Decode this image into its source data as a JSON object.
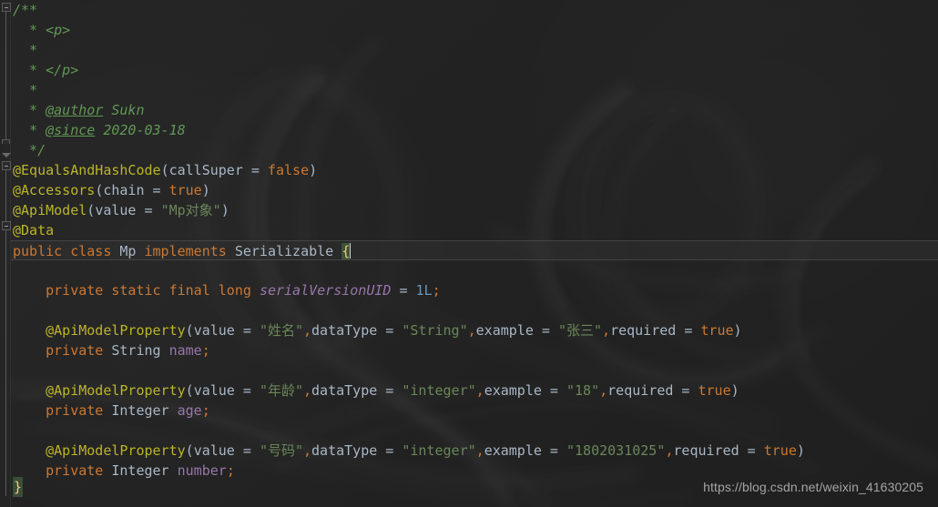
{
  "editor": {
    "language": "java",
    "file_name": "Mp.java",
    "theme": "darcula",
    "colors": {
      "background": "#232323",
      "comment": "#629755",
      "annotation": "#bbb529",
      "keyword": "#cc7832",
      "string": "#6a8759",
      "number": "#6897bb",
      "identifier": "#a9b7c6",
      "field": "#9876aa",
      "brace_highlight": "#ffc66d",
      "caret": "#d0d0d0"
    }
  },
  "gutter": {
    "fold_markers": [
      "collapse-javadoc",
      "collapse-class-annotations",
      "collapse-class-body"
    ]
  },
  "code": {
    "lines": [
      {
        "n": 1,
        "tokens": [
          {
            "t": "/**",
            "c": "c-comment"
          }
        ]
      },
      {
        "n": 2,
        "tokens": [
          {
            "t": "  * ",
            "c": "c-comment"
          },
          {
            "t": "<p>",
            "c": "c-tag"
          }
        ]
      },
      {
        "n": 3,
        "tokens": [
          {
            "t": "  *",
            "c": "c-comment"
          }
        ]
      },
      {
        "n": 4,
        "tokens": [
          {
            "t": "  * ",
            "c": "c-comment"
          },
          {
            "t": "</p>",
            "c": "c-tag"
          }
        ]
      },
      {
        "n": 5,
        "tokens": [
          {
            "t": "  *",
            "c": "c-comment"
          }
        ]
      },
      {
        "n": 6,
        "tokens": [
          {
            "t": "  * ",
            "c": "c-comment"
          },
          {
            "t": "@author",
            "c": "c-doctag"
          },
          {
            "t": " Sukn",
            "c": "c-comment"
          }
        ]
      },
      {
        "n": 7,
        "tokens": [
          {
            "t": "  * ",
            "c": "c-comment"
          },
          {
            "t": "@since",
            "c": "c-doctag"
          },
          {
            "t": " 2020-03-18",
            "c": "c-comment"
          }
        ]
      },
      {
        "n": 8,
        "tokens": [
          {
            "t": "  */",
            "c": "c-comment"
          }
        ]
      },
      {
        "n": 9,
        "tokens": [
          {
            "t": "@EqualsAndHashCode",
            "c": "c-anno"
          },
          {
            "t": "(",
            "c": "c-punc"
          },
          {
            "t": "callSuper",
            "c": "c-ident"
          },
          {
            "t": " = ",
            "c": "c-op"
          },
          {
            "t": "false",
            "c": "c-kw"
          },
          {
            "t": ")",
            "c": "c-punc"
          }
        ]
      },
      {
        "n": 10,
        "tokens": [
          {
            "t": "@Accessors",
            "c": "c-anno"
          },
          {
            "t": "(",
            "c": "c-punc"
          },
          {
            "t": "chain",
            "c": "c-ident"
          },
          {
            "t": " = ",
            "c": "c-op"
          },
          {
            "t": "true",
            "c": "c-kw"
          },
          {
            "t": ")",
            "c": "c-punc"
          }
        ]
      },
      {
        "n": 11,
        "tokens": [
          {
            "t": "@ApiModel",
            "c": "c-anno"
          },
          {
            "t": "(",
            "c": "c-punc"
          },
          {
            "t": "value",
            "c": "c-ident"
          },
          {
            "t": " = ",
            "c": "c-op"
          },
          {
            "t": "\"Mp对象\"",
            "c": "c-str"
          },
          {
            "t": ")",
            "c": "c-punc"
          }
        ]
      },
      {
        "n": 12,
        "tokens": [
          {
            "t": "@Data",
            "c": "c-anno"
          }
        ]
      },
      {
        "n": 13,
        "current": true,
        "caret_after": true,
        "tokens": [
          {
            "t": "public",
            "c": "c-kw"
          },
          {
            "t": " ",
            "c": "c-op"
          },
          {
            "t": "class",
            "c": "c-kw"
          },
          {
            "t": " ",
            "c": "c-op"
          },
          {
            "t": "Mp",
            "c": "c-class"
          },
          {
            "t": " ",
            "c": "c-op"
          },
          {
            "t": "implements",
            "c": "c-kw"
          },
          {
            "t": " ",
            "c": "c-op"
          },
          {
            "t": "Serializable",
            "c": "c-class"
          },
          {
            "t": " ",
            "c": "c-op"
          },
          {
            "t": "{",
            "c": "c-brace-hl"
          }
        ]
      },
      {
        "n": 14,
        "tokens": []
      },
      {
        "n": 15,
        "tokens": [
          {
            "t": "    ",
            "c": "c-op"
          },
          {
            "t": "private",
            "c": "c-kw"
          },
          {
            "t": " ",
            "c": "c-op"
          },
          {
            "t": "static",
            "c": "c-kw"
          },
          {
            "t": " ",
            "c": "c-op"
          },
          {
            "t": "final",
            "c": "c-kw"
          },
          {
            "t": " ",
            "c": "c-op"
          },
          {
            "t": "long",
            "c": "c-kw"
          },
          {
            "t": " ",
            "c": "c-op"
          },
          {
            "t": "serialVersionUID",
            "c": "c-static"
          },
          {
            "t": " = ",
            "c": "c-op"
          },
          {
            "t": "1L",
            "c": "c-num"
          },
          {
            "t": ";",
            "c": "c-comma"
          }
        ]
      },
      {
        "n": 16,
        "tokens": []
      },
      {
        "n": 17,
        "tokens": [
          {
            "t": "    ",
            "c": "c-op"
          },
          {
            "t": "@ApiModelProperty",
            "c": "c-anno"
          },
          {
            "t": "(",
            "c": "c-punc"
          },
          {
            "t": "value",
            "c": "c-ident"
          },
          {
            "t": " = ",
            "c": "c-op"
          },
          {
            "t": "\"姓名\"",
            "c": "c-str"
          },
          {
            "t": ",",
            "c": "c-comma"
          },
          {
            "t": "dataType",
            "c": "c-ident"
          },
          {
            "t": " = ",
            "c": "c-op"
          },
          {
            "t": "\"String\"",
            "c": "c-str"
          },
          {
            "t": ",",
            "c": "c-comma"
          },
          {
            "t": "example",
            "c": "c-ident"
          },
          {
            "t": " = ",
            "c": "c-op"
          },
          {
            "t": "\"张三\"",
            "c": "c-str"
          },
          {
            "t": ",",
            "c": "c-comma"
          },
          {
            "t": "required",
            "c": "c-ident"
          },
          {
            "t": " = ",
            "c": "c-op"
          },
          {
            "t": "true",
            "c": "c-kw"
          },
          {
            "t": ")",
            "c": "c-punc"
          }
        ]
      },
      {
        "n": 18,
        "tokens": [
          {
            "t": "    ",
            "c": "c-op"
          },
          {
            "t": "private",
            "c": "c-kw"
          },
          {
            "t": " ",
            "c": "c-op"
          },
          {
            "t": "String",
            "c": "c-class"
          },
          {
            "t": " ",
            "c": "c-op"
          },
          {
            "t": "name",
            "c": "c-field"
          },
          {
            "t": ";",
            "c": "c-comma"
          }
        ]
      },
      {
        "n": 19,
        "tokens": []
      },
      {
        "n": 20,
        "tokens": [
          {
            "t": "    ",
            "c": "c-op"
          },
          {
            "t": "@ApiModelProperty",
            "c": "c-anno"
          },
          {
            "t": "(",
            "c": "c-punc"
          },
          {
            "t": "value",
            "c": "c-ident"
          },
          {
            "t": " = ",
            "c": "c-op"
          },
          {
            "t": "\"年龄\"",
            "c": "c-str"
          },
          {
            "t": ",",
            "c": "c-comma"
          },
          {
            "t": "dataType",
            "c": "c-ident"
          },
          {
            "t": " = ",
            "c": "c-op"
          },
          {
            "t": "\"integer\"",
            "c": "c-str"
          },
          {
            "t": ",",
            "c": "c-comma"
          },
          {
            "t": "example",
            "c": "c-ident"
          },
          {
            "t": " = ",
            "c": "c-op"
          },
          {
            "t": "\"18\"",
            "c": "c-str"
          },
          {
            "t": ",",
            "c": "c-comma"
          },
          {
            "t": "required",
            "c": "c-ident"
          },
          {
            "t": " = ",
            "c": "c-op"
          },
          {
            "t": "true",
            "c": "c-kw"
          },
          {
            "t": ")",
            "c": "c-punc"
          }
        ]
      },
      {
        "n": 21,
        "tokens": [
          {
            "t": "    ",
            "c": "c-op"
          },
          {
            "t": "private",
            "c": "c-kw"
          },
          {
            "t": " ",
            "c": "c-op"
          },
          {
            "t": "Integer",
            "c": "c-class"
          },
          {
            "t": " ",
            "c": "c-op"
          },
          {
            "t": "age",
            "c": "c-field"
          },
          {
            "t": ";",
            "c": "c-comma"
          }
        ]
      },
      {
        "n": 22,
        "tokens": []
      },
      {
        "n": 23,
        "tokens": [
          {
            "t": "    ",
            "c": "c-op"
          },
          {
            "t": "@ApiModelProperty",
            "c": "c-anno"
          },
          {
            "t": "(",
            "c": "c-punc"
          },
          {
            "t": "value",
            "c": "c-ident"
          },
          {
            "t": " = ",
            "c": "c-op"
          },
          {
            "t": "\"号码\"",
            "c": "c-str"
          },
          {
            "t": ",",
            "c": "c-comma"
          },
          {
            "t": "dataType",
            "c": "c-ident"
          },
          {
            "t": " = ",
            "c": "c-op"
          },
          {
            "t": "\"integer\"",
            "c": "c-str"
          },
          {
            "t": ",",
            "c": "c-comma"
          },
          {
            "t": "example",
            "c": "c-ident"
          },
          {
            "t": " = ",
            "c": "c-op"
          },
          {
            "t": "\"1802031025\"",
            "c": "c-str"
          },
          {
            "t": ",",
            "c": "c-comma"
          },
          {
            "t": "required",
            "c": "c-ident"
          },
          {
            "t": " = ",
            "c": "c-op"
          },
          {
            "t": "true",
            "c": "c-kw"
          },
          {
            "t": ")",
            "c": "c-punc"
          }
        ]
      },
      {
        "n": 24,
        "tokens": [
          {
            "t": "    ",
            "c": "c-op"
          },
          {
            "t": "private",
            "c": "c-kw"
          },
          {
            "t": " ",
            "c": "c-op"
          },
          {
            "t": "Integer",
            "c": "c-class"
          },
          {
            "t": " ",
            "c": "c-op"
          },
          {
            "t": "number",
            "c": "c-field"
          },
          {
            "t": ";",
            "c": "c-comma"
          }
        ]
      },
      {
        "n": 25,
        "tokens": []
      }
    ],
    "closing_brace": "}"
  },
  "watermark": {
    "text": "https://blog.csdn.net/weixin_41630205"
  }
}
